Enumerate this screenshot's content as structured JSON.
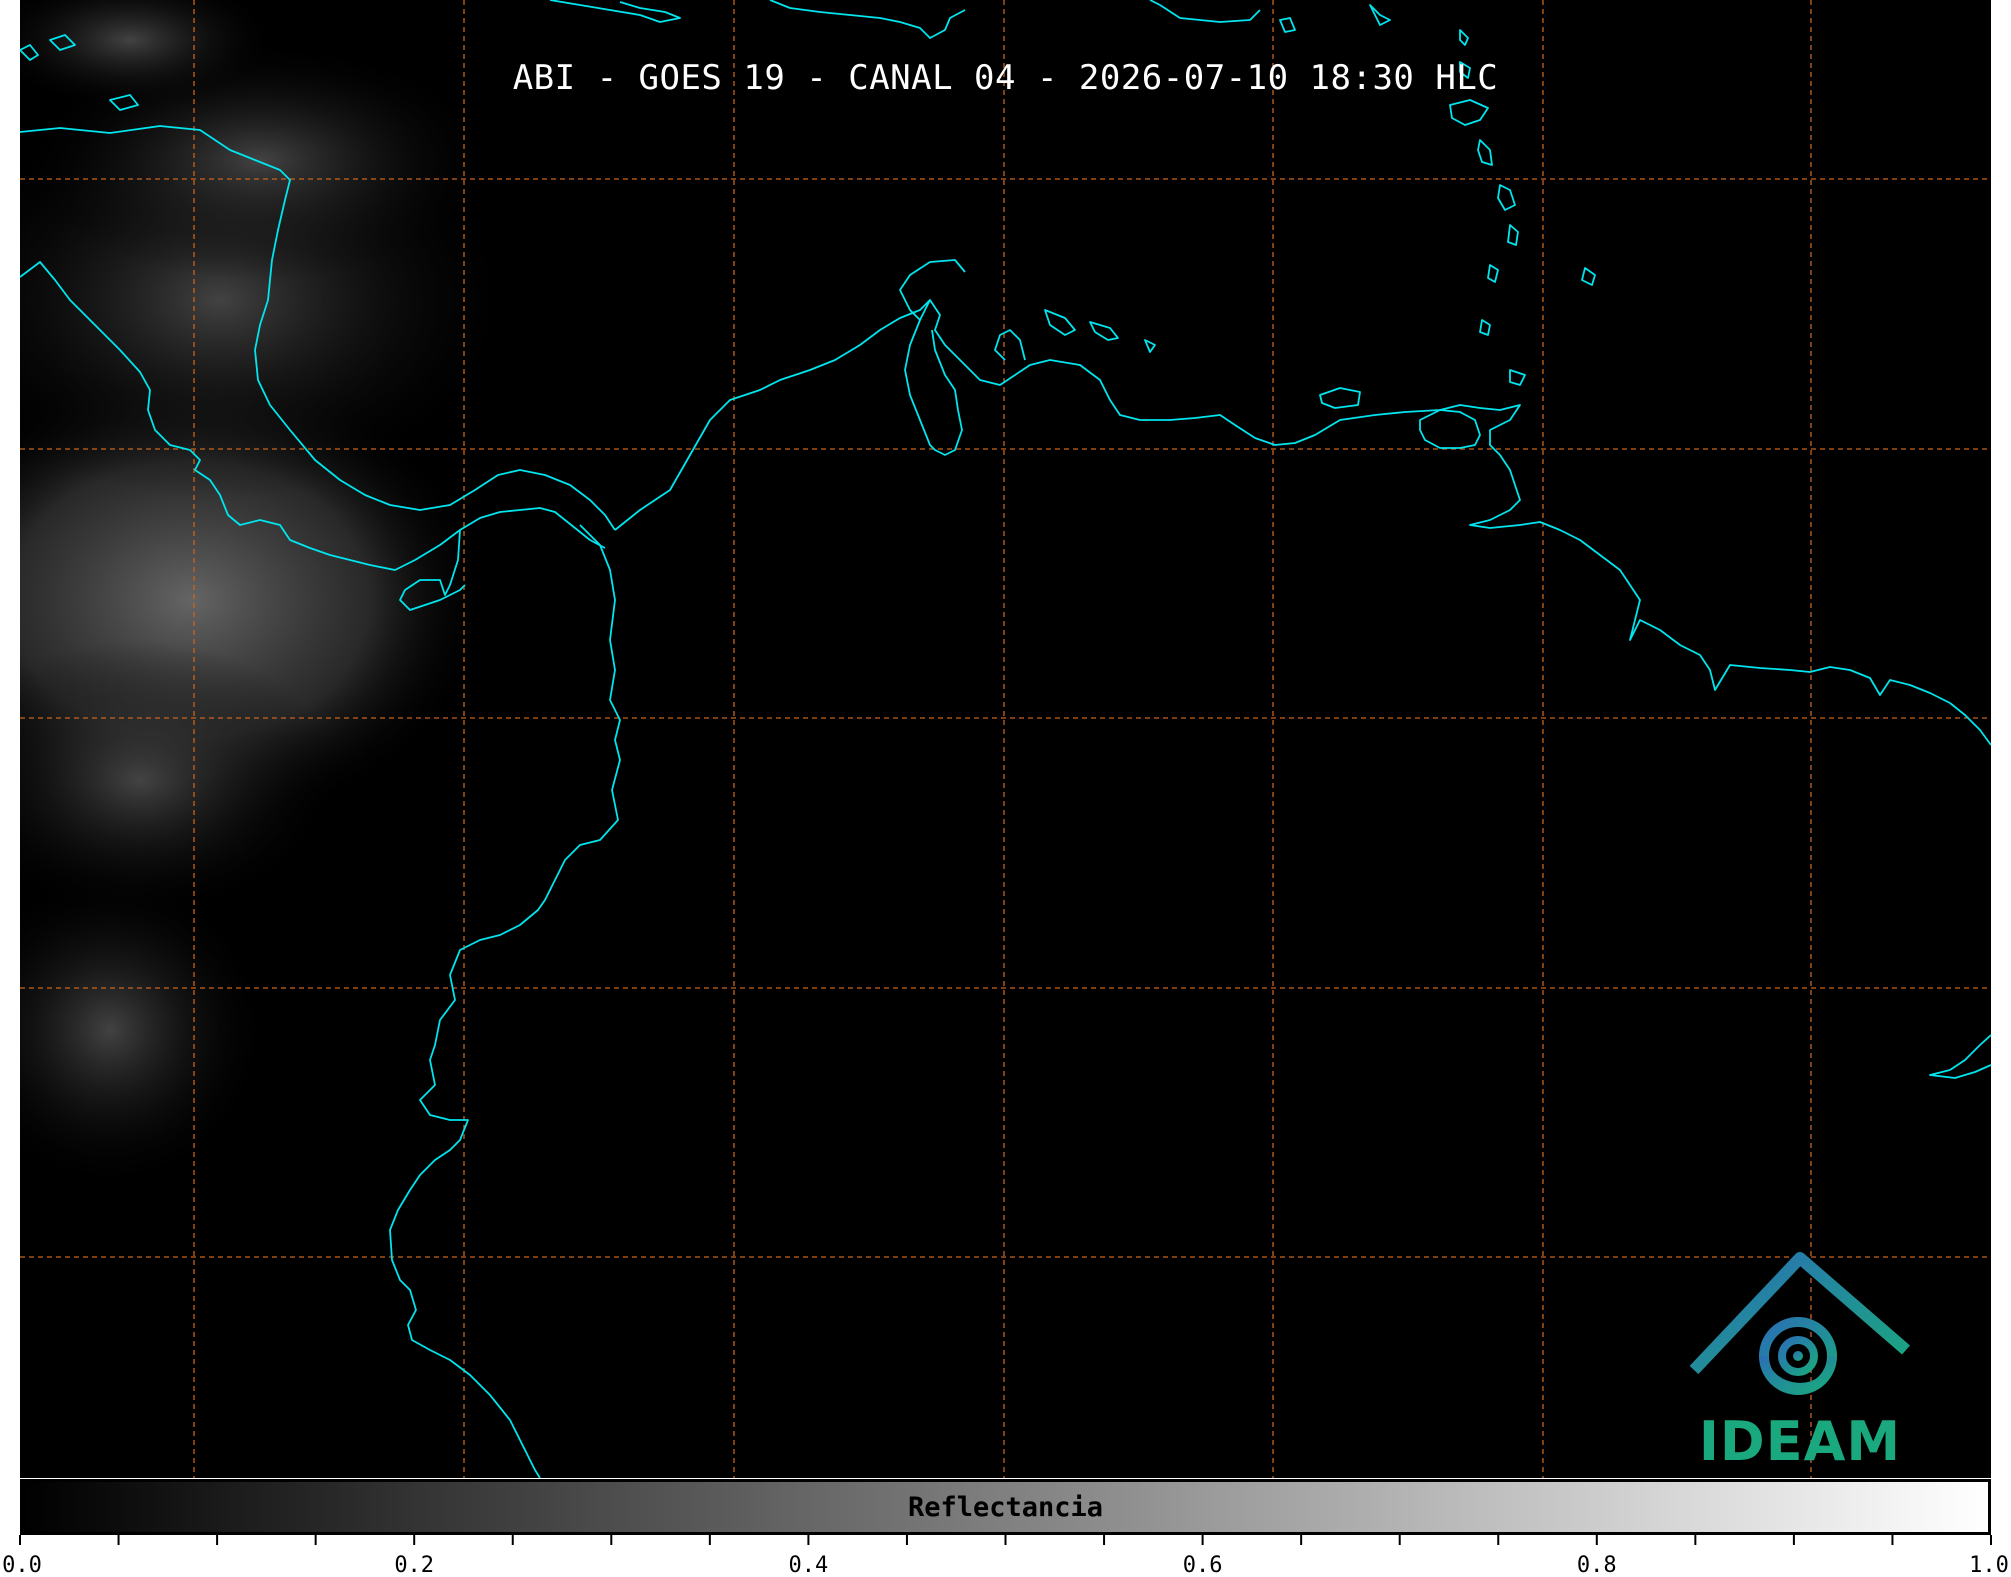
{
  "title": "ABI - GOES 19 - CANAL 04 - 2026-07-10 18:30 HLC",
  "colorbar": {
    "label": "Reflectancia",
    "min": 0.0,
    "max": 1.0,
    "tick_labels": [
      "0.0",
      "0.2",
      "0.4",
      "0.6",
      "0.8",
      "1.0"
    ],
    "tick_values": [
      0.0,
      0.2,
      0.4,
      0.6,
      0.8,
      1.0
    ],
    "minor_step": 0.05,
    "scale": "black-to-white"
  },
  "logo": {
    "text": "IDEAM"
  },
  "colors": {
    "background": "#000000",
    "coastline": "#00e5ee",
    "graticule": "#c8641e",
    "logo_blue": "#2a6fb5",
    "logo_teal": "#1aa87e",
    "title": "#ffffff"
  },
  "map": {
    "graticule": true,
    "graticule_style": "dashed",
    "coastlines": true
  }
}
